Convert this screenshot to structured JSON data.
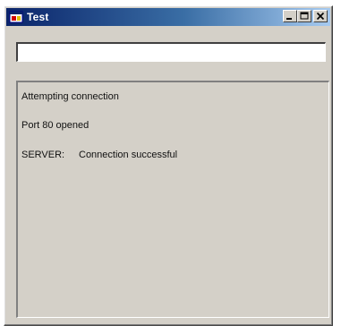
{
  "window": {
    "title": "Test",
    "minimize_symbol": "_",
    "maximize_symbol": "□",
    "close_symbol": "×",
    "icon": "app-window-icon"
  },
  "address": {
    "value": "",
    "placeholder": ""
  },
  "log": {
    "lines": [
      {
        "prefix": "",
        "text": "Attempting connection"
      },
      {
        "prefix": "",
        "text": "Port 80 opened"
      },
      {
        "prefix": "SERVER:",
        "text": "Connection successful"
      }
    ]
  },
  "colors": {
    "face": "#d4d0c8",
    "title_start": "#0a246a",
    "title_end": "#a6caf0"
  }
}
